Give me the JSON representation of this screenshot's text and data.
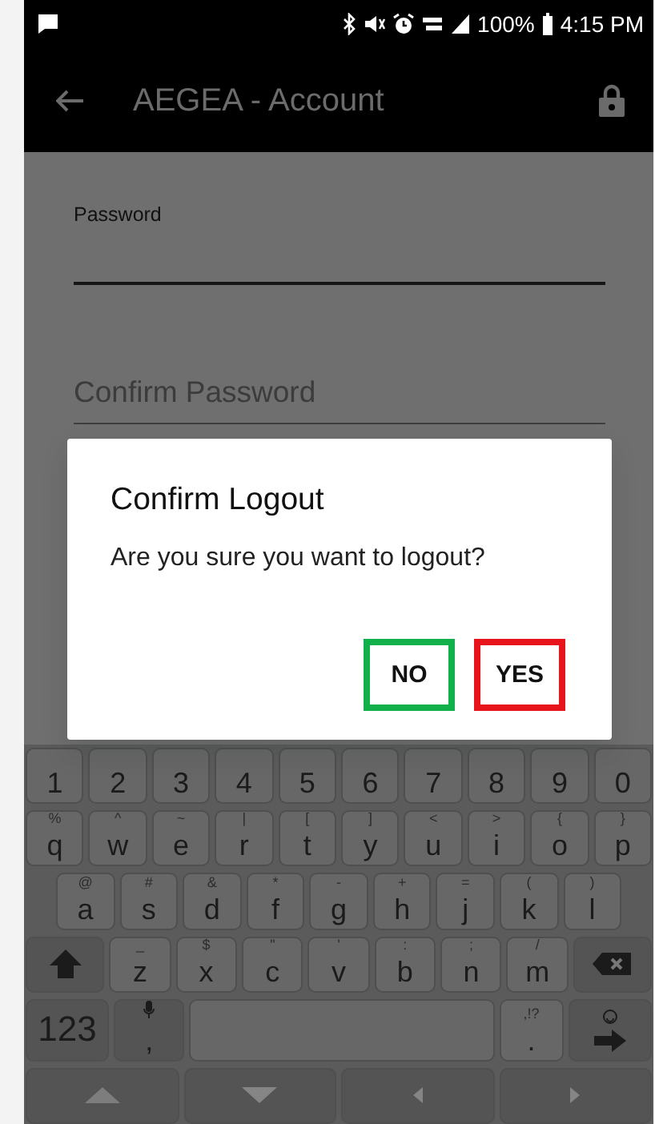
{
  "status_bar": {
    "battery": "100%",
    "time": "4:15 PM"
  },
  "app_bar": {
    "title": "AEGEA - Account"
  },
  "form": {
    "fields": [
      {
        "label": "Password"
      },
      {
        "placeholder": "Confirm Password"
      }
    ]
  },
  "dialog": {
    "title": "Confirm Logout",
    "message": "Are you sure you want to logout?",
    "buttons": [
      {
        "label": "NO",
        "color": "#12b04a"
      },
      {
        "label": "YES",
        "color": "#e8141c"
      }
    ]
  },
  "keyboard": {
    "rows": [
      [
        {
          "kind": "char",
          "label": "1"
        },
        {
          "kind": "char",
          "label": "2"
        },
        {
          "kind": "char",
          "label": "3"
        },
        {
          "kind": "char",
          "label": "4"
        },
        {
          "kind": "char",
          "label": "5"
        },
        {
          "kind": "char",
          "label": "6"
        },
        {
          "kind": "char",
          "label": "7"
        },
        {
          "kind": "char",
          "label": "8"
        },
        {
          "kind": "char",
          "label": "9"
        },
        {
          "kind": "char",
          "label": "0"
        }
      ],
      [
        {
          "kind": "char",
          "label": "q",
          "hint": "%"
        },
        {
          "kind": "char",
          "label": "w",
          "hint": "^"
        },
        {
          "kind": "char",
          "label": "e",
          "hint": "~"
        },
        {
          "kind": "char",
          "label": "r",
          "hint": "|"
        },
        {
          "kind": "char",
          "label": "t",
          "hint": "["
        },
        {
          "kind": "char",
          "label": "y",
          "hint": "]"
        },
        {
          "kind": "char",
          "label": "u",
          "hint": "<"
        },
        {
          "kind": "char",
          "label": "i",
          "hint": ">"
        },
        {
          "kind": "char",
          "label": "o",
          "hint": "{"
        },
        {
          "kind": "char",
          "label": "p",
          "hint": "}"
        }
      ],
      [
        {
          "kind": "char",
          "label": "a",
          "hint": "@"
        },
        {
          "kind": "char",
          "label": "s",
          "hint": "#"
        },
        {
          "kind": "char",
          "label": "d",
          "hint": "&"
        },
        {
          "kind": "char",
          "label": "f",
          "hint": "*"
        },
        {
          "kind": "char",
          "label": "g",
          "hint": "-"
        },
        {
          "kind": "char",
          "label": "h",
          "hint": "+"
        },
        {
          "kind": "char",
          "label": "j",
          "hint": "="
        },
        {
          "kind": "char",
          "label": "k",
          "hint": "("
        },
        {
          "kind": "char",
          "label": "l",
          "hint": ")"
        }
      ],
      [
        {
          "kind": "shift"
        },
        {
          "kind": "char",
          "label": "z",
          "hint": "_"
        },
        {
          "kind": "char",
          "label": "x",
          "hint": "$"
        },
        {
          "kind": "char",
          "label": "c",
          "hint": "\""
        },
        {
          "kind": "char",
          "label": "v",
          "hint": "'"
        },
        {
          "kind": "char",
          "label": "b",
          "hint": ":"
        },
        {
          "kind": "char",
          "label": "n",
          "hint": ";"
        },
        {
          "kind": "char",
          "label": "m",
          "hint": "/"
        },
        {
          "kind": "backspace"
        }
      ],
      [
        {
          "kind": "mode",
          "label": "123"
        },
        {
          "kind": "mic",
          "label": ","
        },
        {
          "kind": "space"
        },
        {
          "kind": "char",
          "label": ".",
          "hint": ",!?"
        },
        {
          "kind": "enter"
        }
      ],
      [
        {
          "kind": "up"
        },
        {
          "kind": "down"
        },
        {
          "kind": "left"
        },
        {
          "kind": "right"
        }
      ]
    ]
  }
}
